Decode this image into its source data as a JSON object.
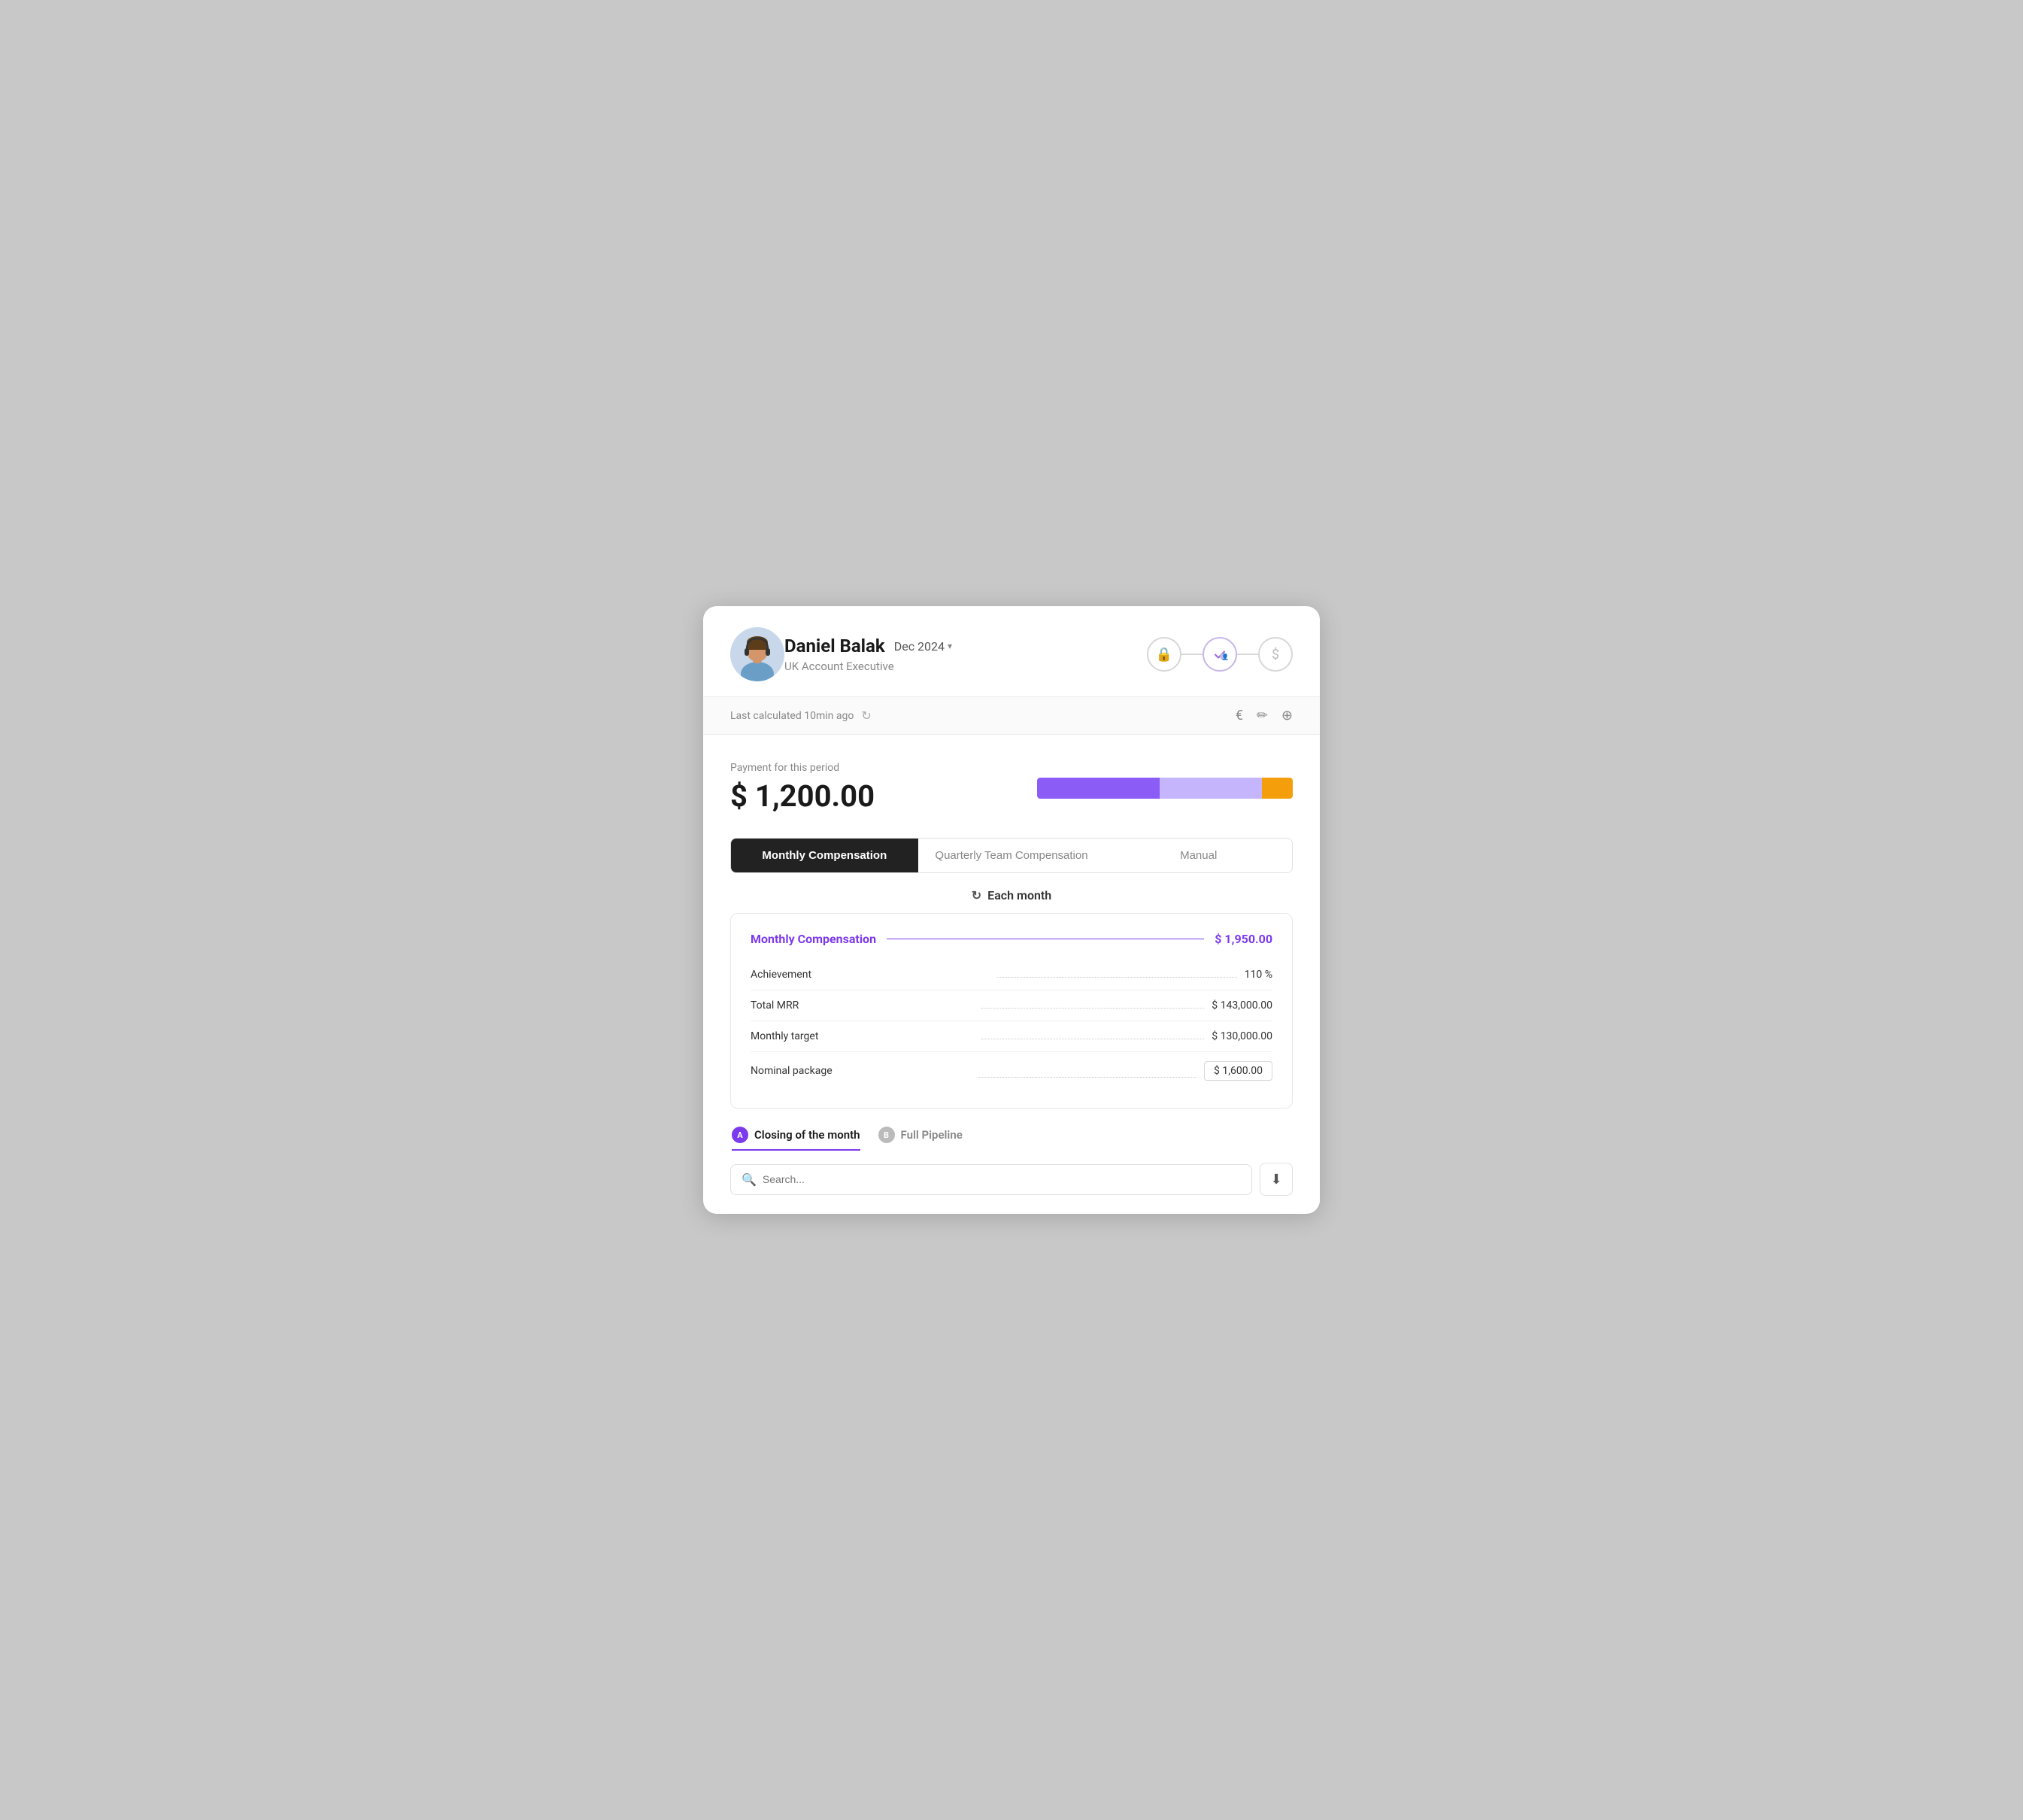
{
  "header": {
    "name": "Daniel Balak",
    "period": "Dec 2024",
    "role": "UK Account Executive",
    "steps": [
      {
        "icon": "🔒",
        "active": false
      },
      {
        "icon": "✓",
        "active": true
      },
      {
        "icon": "👤",
        "active": true
      },
      {
        "icon": "$",
        "active": false
      }
    ]
  },
  "toolbar": {
    "last_calculated": "Last calculated 10min ago",
    "currency_icon": "€",
    "edit_icon": "✏",
    "add_icon": "⊕"
  },
  "payment": {
    "label": "Payment for this period",
    "amount": "$ 1,200.00",
    "bar": [
      {
        "color": "#8b5cf6",
        "pct": 48
      },
      {
        "color": "#c4b5fd",
        "pct": 40
      },
      {
        "color": "#f59e0b",
        "pct": 12
      }
    ]
  },
  "tabs": [
    {
      "label": "Monthly Compensation",
      "active": true
    },
    {
      "label": "Quarterly Team Compensation",
      "active": false
    },
    {
      "label": "Manual",
      "active": false
    }
  ],
  "period_row": {
    "icon": "↻",
    "label": "Each month"
  },
  "comp_card": {
    "title": "Monthly Compensation",
    "total": "$ 1,950.00",
    "rows": [
      {
        "label": "Achievement",
        "value": "110 %",
        "boxed": false
      },
      {
        "label": "Total MRR",
        "value": "$ 143,000.00",
        "boxed": false
      },
      {
        "label": "Monthly target",
        "value": "$ 130,000.00",
        "boxed": false
      },
      {
        "label": "Nominal package",
        "value": "$ 1,600.00",
        "boxed": true
      }
    ]
  },
  "sub_tabs": [
    {
      "badge": "A",
      "badge_style": "purple",
      "label": "Closing of the month",
      "active": true
    },
    {
      "badge": "B",
      "badge_style": "gray",
      "label": "Full Pipeline",
      "active": false
    }
  ],
  "search": {
    "placeholder": "Search..."
  }
}
